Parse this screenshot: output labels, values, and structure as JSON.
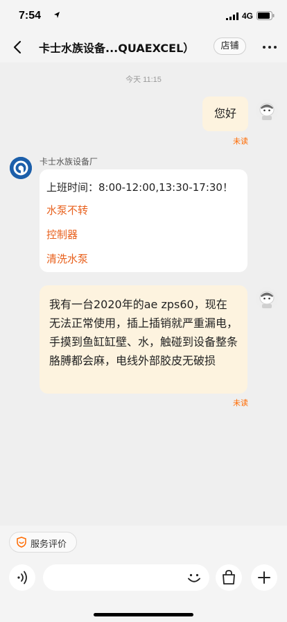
{
  "status": {
    "time": "7:54",
    "network": "4G"
  },
  "nav": {
    "title": "卡士水族设备...QUAEXCEL）",
    "store_label": "店铺"
  },
  "chat": {
    "timestamp": "今天 11:15",
    "msg1": {
      "text": "您好",
      "status": "未读"
    },
    "shop": {
      "name": "卡士水族设备厂",
      "hours": "上班时间：8:00-12:00,13:30-17:30！",
      "links": [
        "水泵不转",
        "控制器",
        "清洗水泵"
      ]
    },
    "msg2": {
      "text": "我有一台2020年的ae zps60，现在无法正常使用，插上插销就严重漏电，手摸到鱼缸缸壁、水，触碰到设备整条胳膊都会麻，电线外部胶皮无破损",
      "status": "未读"
    }
  },
  "bottom": {
    "rate_label": "服务评价",
    "input_placeholder": ""
  },
  "colors": {
    "accent": "#ff6a00",
    "self_bubble": "#fdf3df",
    "link": "#e8601c",
    "shop_avatar": "#1c5faa"
  }
}
